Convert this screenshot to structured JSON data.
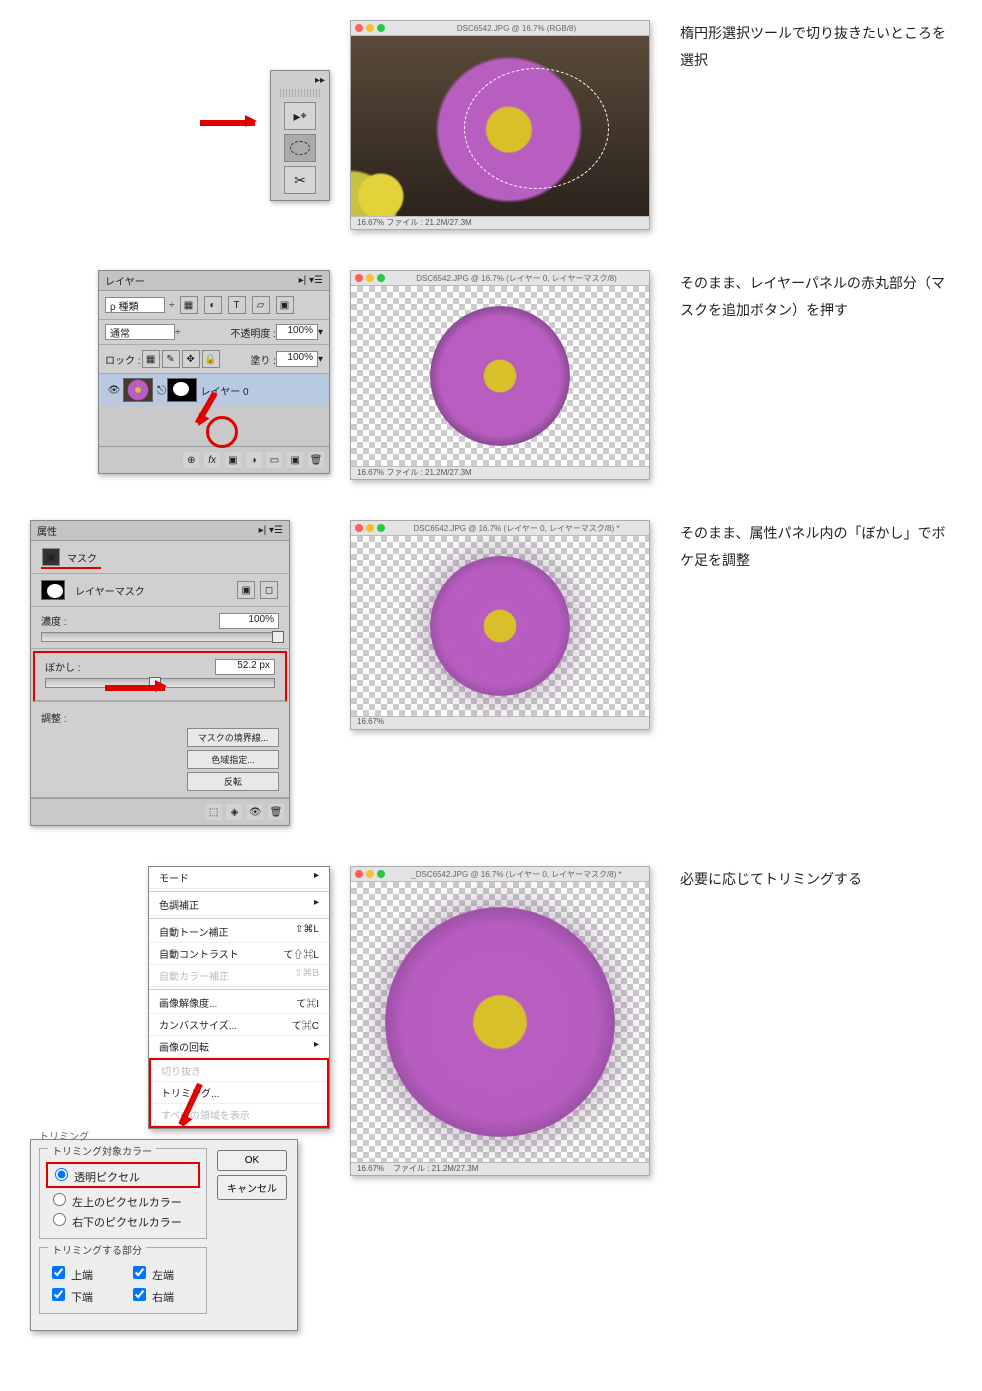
{
  "step1": {
    "caption": "楕円形選択ツールで切り抜きたいところを選択",
    "window_title": "DSC6542.JPG @ 16.7% (RGB/8)",
    "status": "16.67%    ファイル : 21.2M/27.3M"
  },
  "step2": {
    "caption": "そのまま、レイヤーパネルの赤丸部分（マスクを追加ボタン）を押す",
    "panel_title": "レイヤー",
    "filter_label": "ρ 種類",
    "blend_mode": "通常",
    "opacity_label": "不透明度 :",
    "opacity_value": "100%",
    "lock_label": "ロック :",
    "fill_label": "塗り :",
    "fill_value": "100%",
    "layer_name": "レイヤー 0",
    "window_title": "DSC6542.JPG @ 16.7% (レイヤー 0, レイヤーマスク/8)",
    "status": "16.67%    ファイル : 21.2M/27.3M",
    "footer_icons": [
      "⊕",
      "fx",
      "▣",
      "◑",
      "▭",
      "▣",
      "🗑"
    ]
  },
  "step3": {
    "caption": "そのまま、属性パネル内の「ぼかし」でボケ足を調整",
    "panel_title": "属性",
    "tab_mask": "マスク",
    "type_label": "レイヤーマスク",
    "density_label": "濃度 :",
    "density_value": "100%",
    "feather_label": "ぼかし :",
    "feather_value": "52.2 px",
    "refine_label": "調整 :",
    "btn_refine": "マスクの境界線...",
    "btn_colorrange": "色域指定...",
    "btn_invert": "反転",
    "window_title": "DSC6542.JPG @ 16.7% (レイヤー 0, レイヤーマスク/8) *",
    "status": "16.67%"
  },
  "step4": {
    "caption": "必要に応じてトリミングする",
    "menu": {
      "mode": "モード",
      "toneadj": "色調補正",
      "auto_tone": "自動トーン補正",
      "auto_tone_sc": "⇧⌘L",
      "auto_contrast": "自動コントラスト",
      "auto_contrast_sc": "て⇧⌘L",
      "auto_color": "自動カラー補正",
      "auto_color_sc": "⇧⌘B",
      "image_size": "画像解像度...",
      "image_size_sc": "て⌘I",
      "canvas_size": "カンバスサイズ...",
      "canvas_size_sc": "て⌘C",
      "rotate": "画像の回転",
      "crop": "切り抜き",
      "trim": "トリミング...",
      "reveal": "すべての領域を表示"
    },
    "trim_dialog": {
      "title": "トリミング",
      "group1": "トリミング対象カラー",
      "opt_transparent": "透明ピクセル",
      "opt_topleft": "左上のピクセルカラー",
      "opt_bottomright": "右下のピクセルカラー",
      "group2": "トリミングする部分",
      "chk_top": "上端",
      "chk_left": "左端",
      "chk_bottom": "下端",
      "chk_right": "右端",
      "ok": "OK",
      "cancel": "キャンセル"
    },
    "window_title": "_DSC6542.JPG @ 16.7% (レイヤー 0, レイヤーマスク/8) *",
    "status_pct": "16.67%",
    "status_file": "ファイル : 21.2M/27.3M"
  }
}
